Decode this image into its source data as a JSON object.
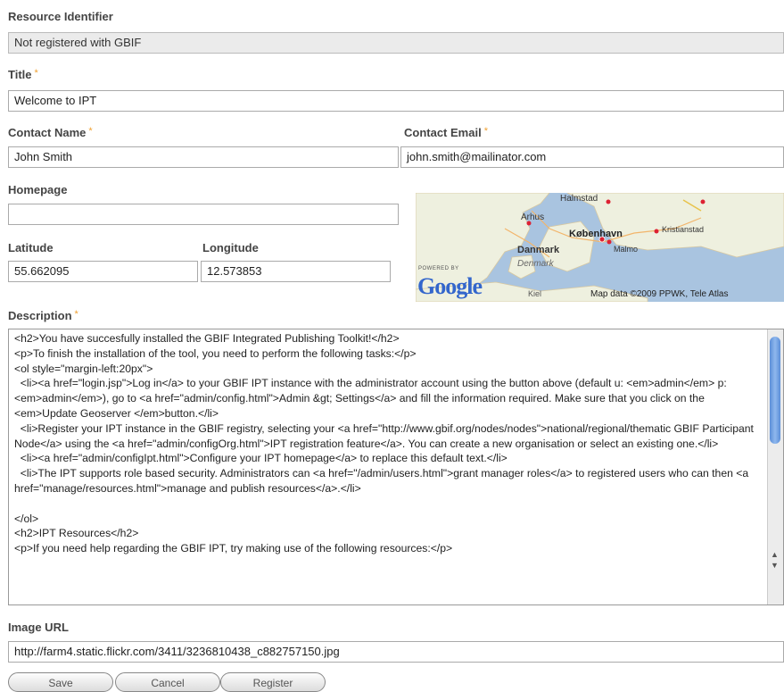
{
  "resource_identifier": {
    "label": "Resource Identifier",
    "value": "Not registered with GBIF"
  },
  "title": {
    "label": "Title",
    "required_mark": "*",
    "value": "Welcome to IPT"
  },
  "contact_name": {
    "label": "Contact Name",
    "required_mark": "*",
    "value": "John Smith"
  },
  "contact_email": {
    "label": "Contact Email",
    "required_mark": "*",
    "value": "john.smith@mailinator.com"
  },
  "homepage": {
    "label": "Homepage",
    "value": ""
  },
  "latitude": {
    "label": "Latitude",
    "value": "55.662095"
  },
  "longitude": {
    "label": "Longitude",
    "value": "12.573853"
  },
  "map": {
    "powered_by": "POWERED BY",
    "logo": "Google",
    "attribution": "Map data ©2009 PPWK, Tele Atlas",
    "places": [
      "Halmstad",
      "Arhus",
      "København",
      "Kristianstad",
      "Danmark",
      "Malmo",
      "Denmark",
      "Kiel"
    ],
    "colors": {
      "water": "#a9c4e0",
      "land": "#eef0df"
    }
  },
  "description": {
    "label": "Description",
    "required_mark": "*",
    "value": "<h2>You have succesfully installed the GBIF Integrated Publishing Toolkit!</h2>\n<p>To finish the installation of the tool, you need to perform the following tasks:</p>\n<ol style=\"margin-left:20px\">\n  <li><a href=\"login.jsp\">Log in</a> to your GBIF IPT instance with the administrator account using the button above (default u: <em>admin</em> p: <em>admin</em>), go to <a href=\"admin/config.html\">Admin &gt; Settings</a> and fill the information required. Make sure that you click on the <em>Update Geoserver </em>button.</li>\n  <li>Register your IPT instance in the GBIF registry, selecting your <a href=\"http://www.gbif.org/nodes/nodes\">national/regional/thematic GBIF Participant Node</a> using the <a href=\"admin/configOrg.html\">IPT registration feature</a>. You can create a new organisation or select an existing one.</li>\n  <li><a href=\"admin/configIpt.html\">Configure your IPT homepage</a> to replace this default text.</li>\n  <li>The IPT supports role based security. Administrators can <a href=\"/admin/users.html\">grant manager roles</a> to registered users who can then <a href=\"manage/resources.html\">manage and publish resources</a>.</li>\n\n</ol>\n<h2>IPT Resources</h2>\n<p>If you need help regarding the GBIF IPT, try making use of the following resources:</p>"
  },
  "image_url": {
    "label": "Image URL",
    "value": "http://farm4.static.flickr.com/3411/3236810438_c882757150.jpg"
  },
  "buttons": {
    "save": "Save",
    "cancel": "Cancel",
    "register": "Register"
  }
}
